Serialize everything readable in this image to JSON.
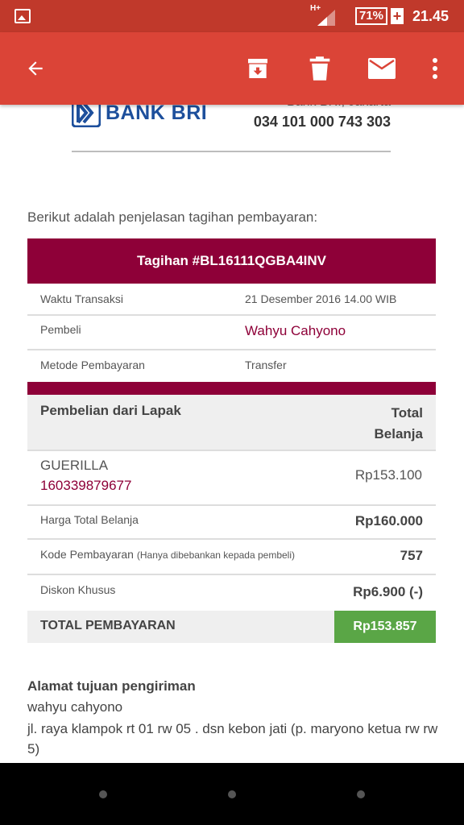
{
  "status_bar": {
    "network": "H+",
    "battery": "71%",
    "charging": "+",
    "time": "21.45"
  },
  "toolbar": {
    "icons": [
      "back-arrow-icon",
      "archive-icon",
      "trash-icon",
      "mail-icon",
      "more-vert-icon"
    ]
  },
  "bank": {
    "logo_text": "BANK BRI",
    "branch": "Bank BRI, Jakarta",
    "account": "034 101 000 743 303"
  },
  "intro": "Berikut adalah penjelasan tagihan pembayaran:",
  "invoice": {
    "title": "Tagihan #BL16111QGBA4INV",
    "rows": [
      {
        "label": "Waktu Transaksi",
        "value": "21 Desember 2016 14.00 WIB"
      },
      {
        "label": "Pembeli",
        "value": "Wahyu Cahyono"
      },
      {
        "label": "Metode Pembayaran",
        "value": "Transfer"
      }
    ]
  },
  "purchase": {
    "col_left": "Pembelian dari Lapak",
    "col_right_1": "Total",
    "col_right_2": "Belanja",
    "item": {
      "name": "GUERILLA",
      "code": "160339879677",
      "price": "Rp153.100"
    },
    "summary": [
      {
        "label": "Harga Total Belanja",
        "note": "",
        "value": "Rp160.000"
      },
      {
        "label": "Kode Pembayaran",
        "note": "(Hanya dibebankan kepada pembeli)",
        "value": "757"
      },
      {
        "label": "Diskon Khusus",
        "note": "",
        "value": "Rp6.900 (-)"
      }
    ],
    "total_label": "TOTAL PEMBAYARAN",
    "total_value": "Rp153.857"
  },
  "address": {
    "title": "Alamat tujuan pengiriman",
    "name": "wahyu cahyono",
    "line": "jl. raya klampok rt 01 rw 05 . dsn kebon jati (p. maryono ketua rw rw 5)"
  },
  "colors": {
    "status_bar": "#c0392b",
    "toolbar": "#db4437",
    "brand_maroon": "#8e0038",
    "total_green": "#5aa646",
    "bri_blue": "#1d4f9c"
  }
}
